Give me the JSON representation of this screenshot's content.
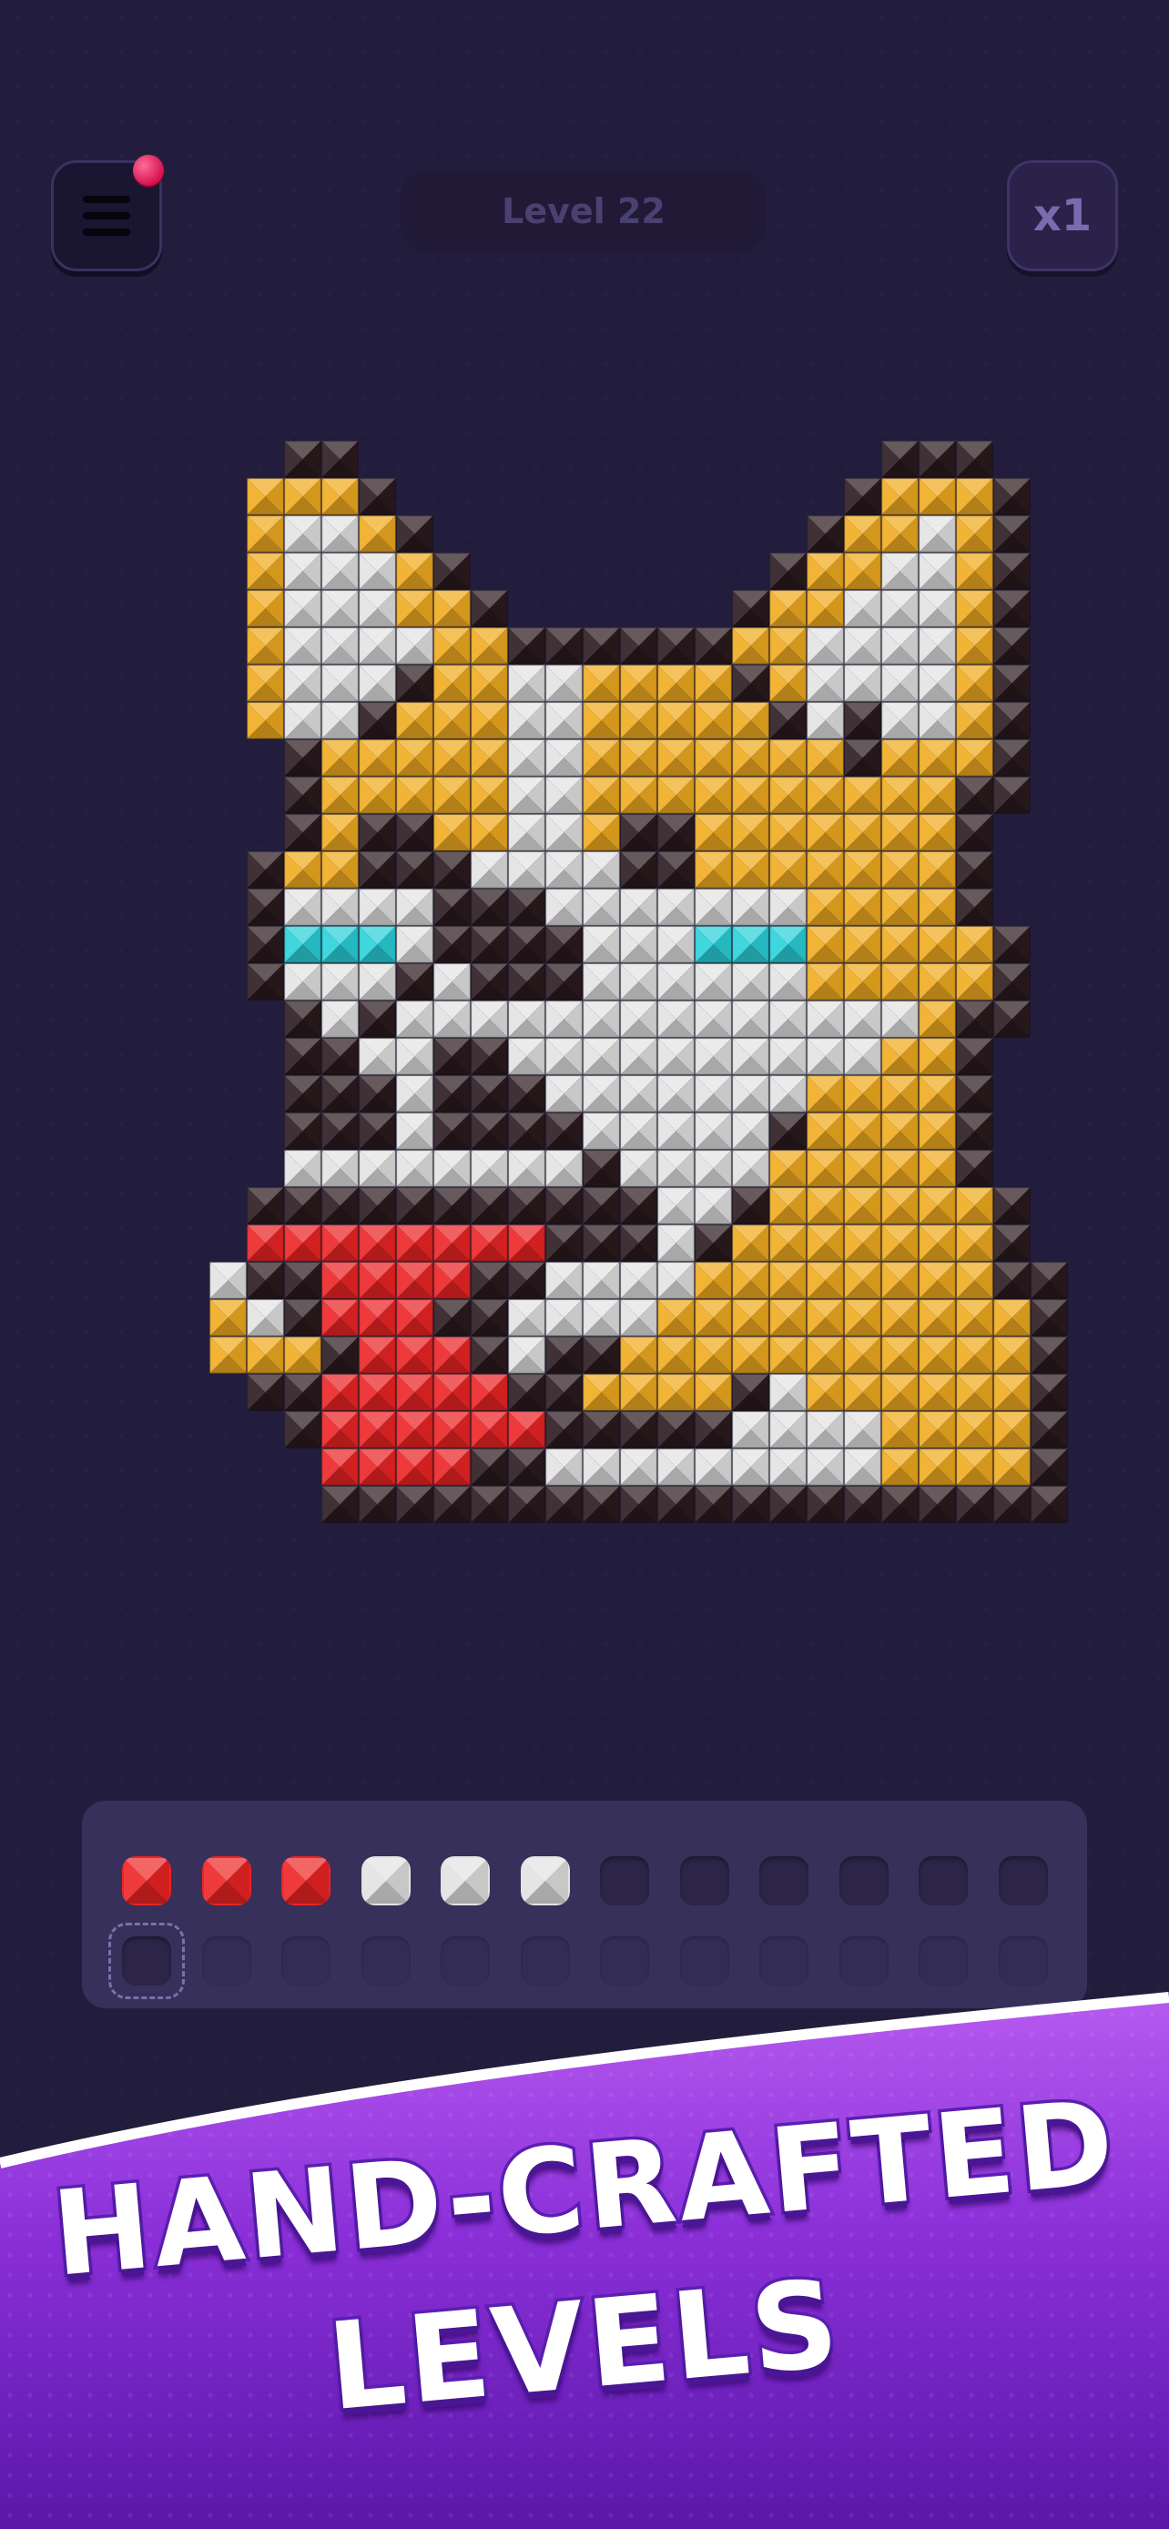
{
  "header": {
    "level_label": "Level 22",
    "multiplier_label": "x1",
    "menu_has_notification": true
  },
  "palette": {
    "background": "#231d3d",
    "outline": "#2a1a1e",
    "orange": "#f0ac20",
    "white": "#e3e3e3",
    "cyan": "#2ad1d9",
    "red": "#ec2424",
    "tray": "#37305a",
    "banner_purple": "#a748ea"
  },
  "pixel_art": {
    "subject": "dog head with tongue out",
    "legend": {
      "K": "outline",
      "O": "orange",
      "W": "white",
      "C": "cyan",
      "R": "red"
    },
    "rows": [
      "...KK..............KKK..",
      "..OOOK............KOOOK.",
      "..OWWOK..........KOOWOK.",
      "..OWWWOK........KOOWWOK.",
      "..OWWWOOK......KOOWWWOK.",
      "..OWWWWOOKKKKKKOOWWWWOK.",
      "..OWWWKOOWWOOOOKOWWWWOK.",
      "..OWWKOOOWWOOOOOKWKWWOK.",
      "...KOOOOOWWOOOOOOOKOOOK.",
      "...KOOOOOWWOOOOOOOOOOKK.",
      "...KOKKOOWWOKKOOOOOOOK..",
      "..KOOKKKWWWWKKOOOOOOOK..",
      "..KWWWWKKKWWWWWWWOOOOK..",
      "..KCCCWKKKKWWWCCCOOOOOK.",
      "..KWWWKWKKKWWWWWWOOOOOK.",
      "...KWKWWWWWWWWWWWWWWOKK.",
      "...KKWWKKWWWWWWWWWWOOK..",
      "...KKKWKKKWWWWWWWOOOOK..",
      "...KKKWKKKKWWWWWKOOOOK..",
      "...WWWWWWWWKWWWWOOOOOK..",
      "..KKKKKKKKKKKWWKOOOOOOK.",
      "..RRRRRRRRKKKWKOOOOOOOK.",
      ".WKKRRRRKKWWWWOOOOOOOOKK",
      ".OWKRRRKKWWWWOOOOOOOOOOK",
      ".OOOKRRRKWKKOOOOOOOOOOOK",
      "..KKRRRRRKKOOOOKWOOOOOOK",
      "...KRRRRRRKKKKKWWWWOOOOK",
      "....RRRRKKWWWWWWWWWOOOOK",
      "....KKKKKKKKKKKKKKKKKKKK"
    ]
  },
  "tray": {
    "rows": [
      [
        "red",
        "red",
        "red",
        "white",
        "white",
        "white",
        "empty",
        "empty",
        "empty",
        "empty",
        "empty",
        "empty"
      ],
      [
        "empty-active",
        "empty-dim",
        "empty-dim",
        "empty-dim",
        "empty-dim",
        "empty-dim",
        "empty-dim",
        "empty-dim",
        "empty-dim",
        "empty-dim",
        "empty-dim",
        "empty-dim"
      ]
    ]
  },
  "banner": {
    "line1": "HAND-CRAFTED",
    "line2": "LEVELS"
  }
}
